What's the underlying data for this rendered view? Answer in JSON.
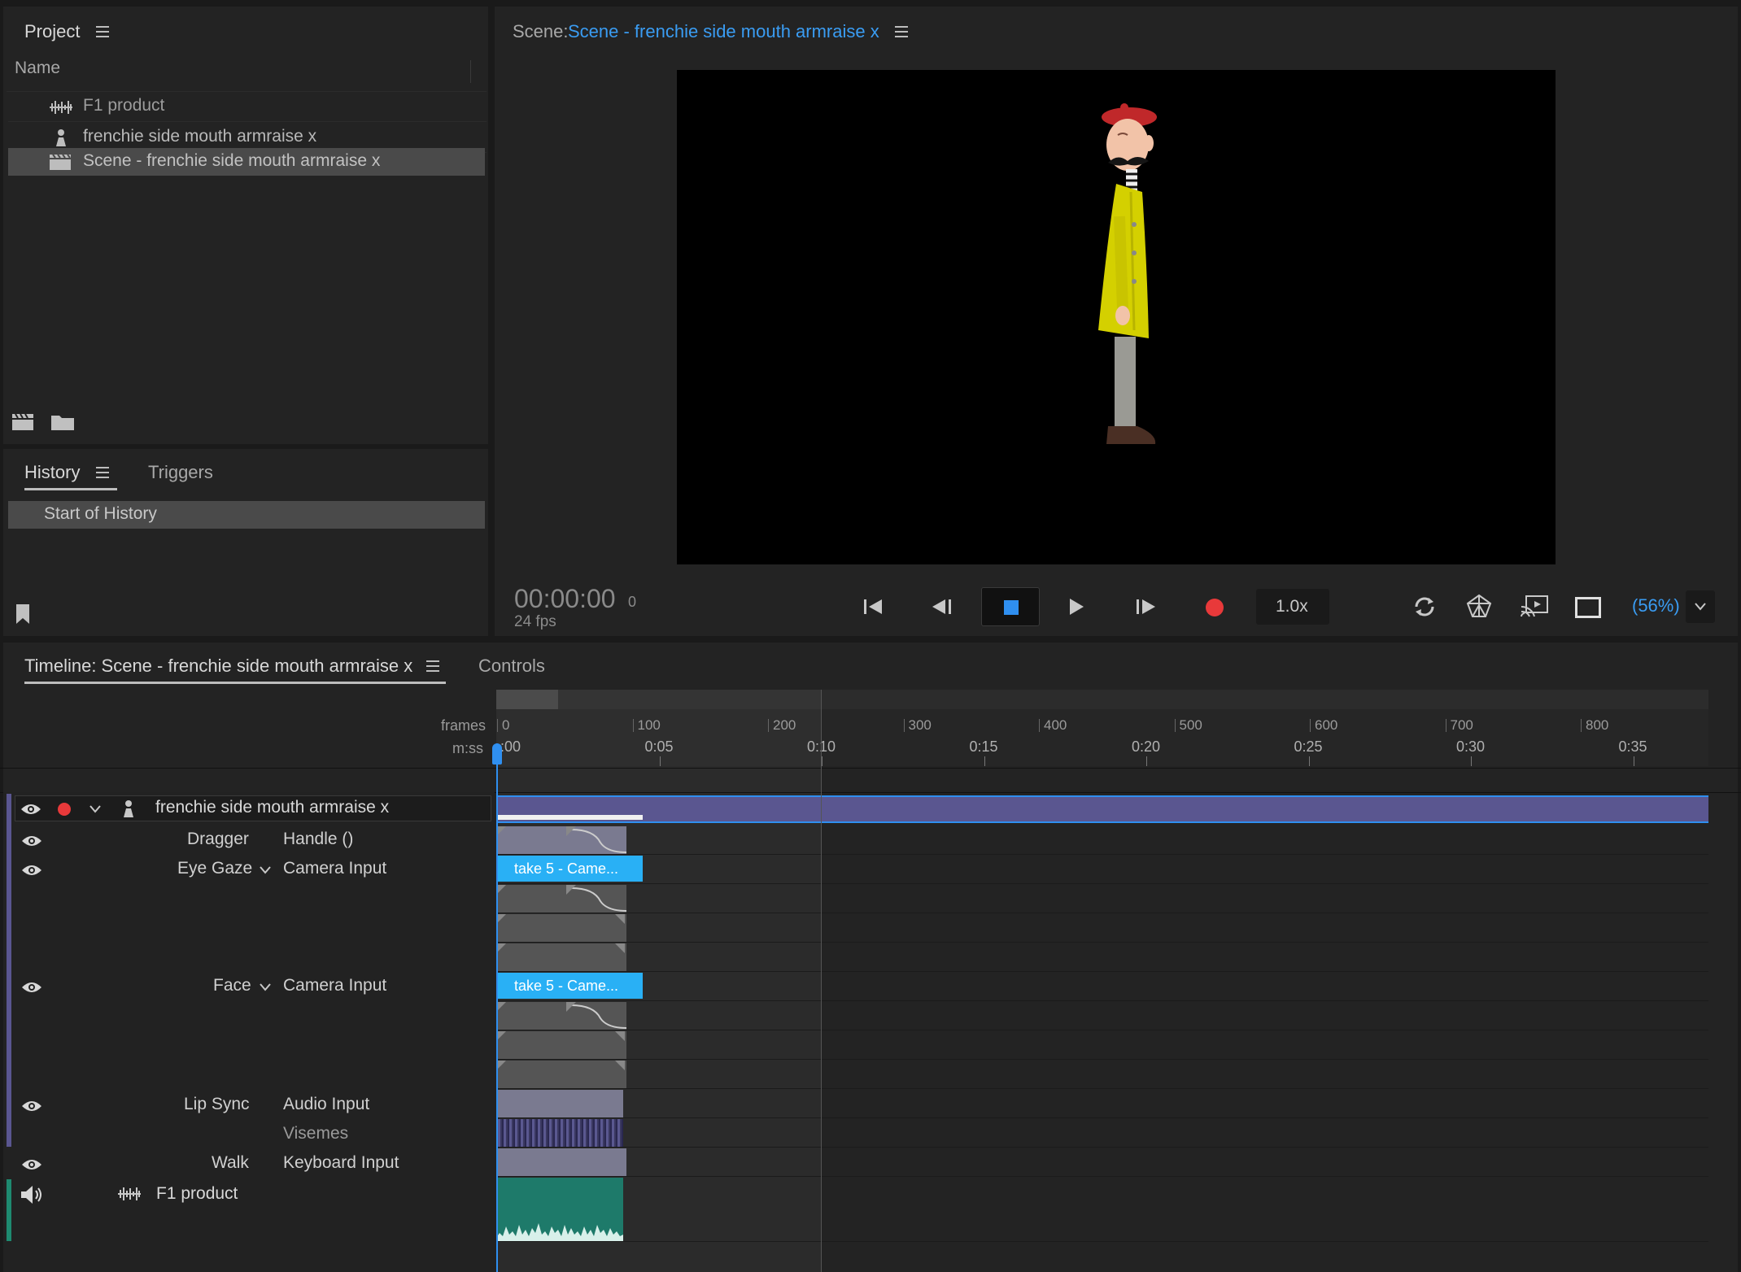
{
  "project": {
    "title": "Project",
    "column_name": "Name",
    "items": [
      {
        "label": "F1 product",
        "icon": "audio-waveform-icon"
      },
      {
        "label": "frenchie side mouth armraise x",
        "icon": "puppet-icon"
      },
      {
        "label": "Scene - frenchie side mouth armraise x",
        "icon": "scene-clapper-icon",
        "selected": true
      }
    ]
  },
  "history": {
    "tab_history": "History",
    "tab_triggers": "Triggers",
    "items": [
      "Start of History"
    ]
  },
  "scene": {
    "prefix": "Scene:",
    "name": "Scene - frenchie side mouth armraise x",
    "timecode": "00:00:00",
    "frame": "0",
    "fps": "24 fps",
    "speed": "1.0x",
    "zoom": "(56%)"
  },
  "timeline": {
    "tab_timeline": "Timeline: Scene - frenchie side mouth armraise x",
    "tab_controls": "Controls",
    "ruler_frames_label": "frames",
    "ruler_mss_label": "m:ss",
    "frames_ticks": [
      "0",
      "100",
      "200",
      "300",
      "400",
      "500",
      "600",
      "700",
      "800"
    ],
    "time_ticks": [
      ":00",
      "0:05",
      "0:10",
      "0:15",
      "0:20",
      "0:25",
      "0:30",
      "0:35"
    ],
    "puppet_track": "frenchie side mouth armraise x",
    "behaviors": [
      {
        "name": "Dragger",
        "input": "Handle ()"
      },
      {
        "name": "Eye Gaze",
        "input": "Camera Input"
      },
      {
        "name": "Face",
        "input": "Camera Input"
      },
      {
        "name": "Lip Sync",
        "input": "Audio Input",
        "sub": "Visemes"
      },
      {
        "name": "Walk",
        "input": "Keyboard Input"
      }
    ],
    "audio_track": "F1 product",
    "clip_label": "take 5 - Came..."
  },
  "colors": {
    "accent": "#3a9cf2",
    "record": "#e8393a",
    "clip_blue": "#29b0f5",
    "audio_teal": "#1e7a6a",
    "puppet_bar": "#5a5690"
  }
}
